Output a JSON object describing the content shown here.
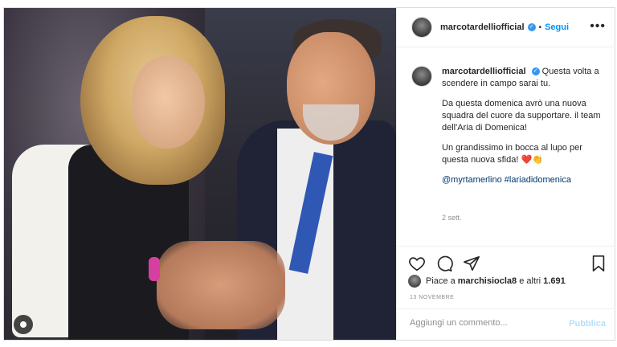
{
  "post": {
    "username": "marcotardelliofficial",
    "dot": "•",
    "follow_label": "Segui",
    "more_label": "•••",
    "caption": {
      "username": "marcotardelliofficial",
      "line1": "Questa volta a scendere in campo sarai tu.",
      "line2": "Da questa domenica avrò una nuova squadra del cuore da supportare. il team dell'Aria di Domenica!",
      "line3": "Un grandissimo in bocca al lupo per questa nuova sfida!",
      "emoji": "❤️👏",
      "tag1": "@myrtamerlino",
      "tag2": "#laria​didomenica"
    },
    "time_ago": "2 sett.",
    "likes_prefix": "Piace a",
    "likes_user": "marchisiocla8",
    "likes_suffix": "e altri",
    "likes_count": "1.691",
    "date": "13 NOVEMBRE",
    "comment_placeholder": "Aggiungi un commento...",
    "publish_label": "Pubblica"
  },
  "icons": [
    "heart-icon",
    "comment-icon",
    "share-icon",
    "bookmark-icon",
    "verified-icon",
    "user-tag-icon"
  ],
  "colors": {
    "link": "#0095f6",
    "verified": "#3897f0",
    "text": "#262626",
    "muted": "#8e8e8e",
    "publish_disabled": "#b2dffc"
  }
}
